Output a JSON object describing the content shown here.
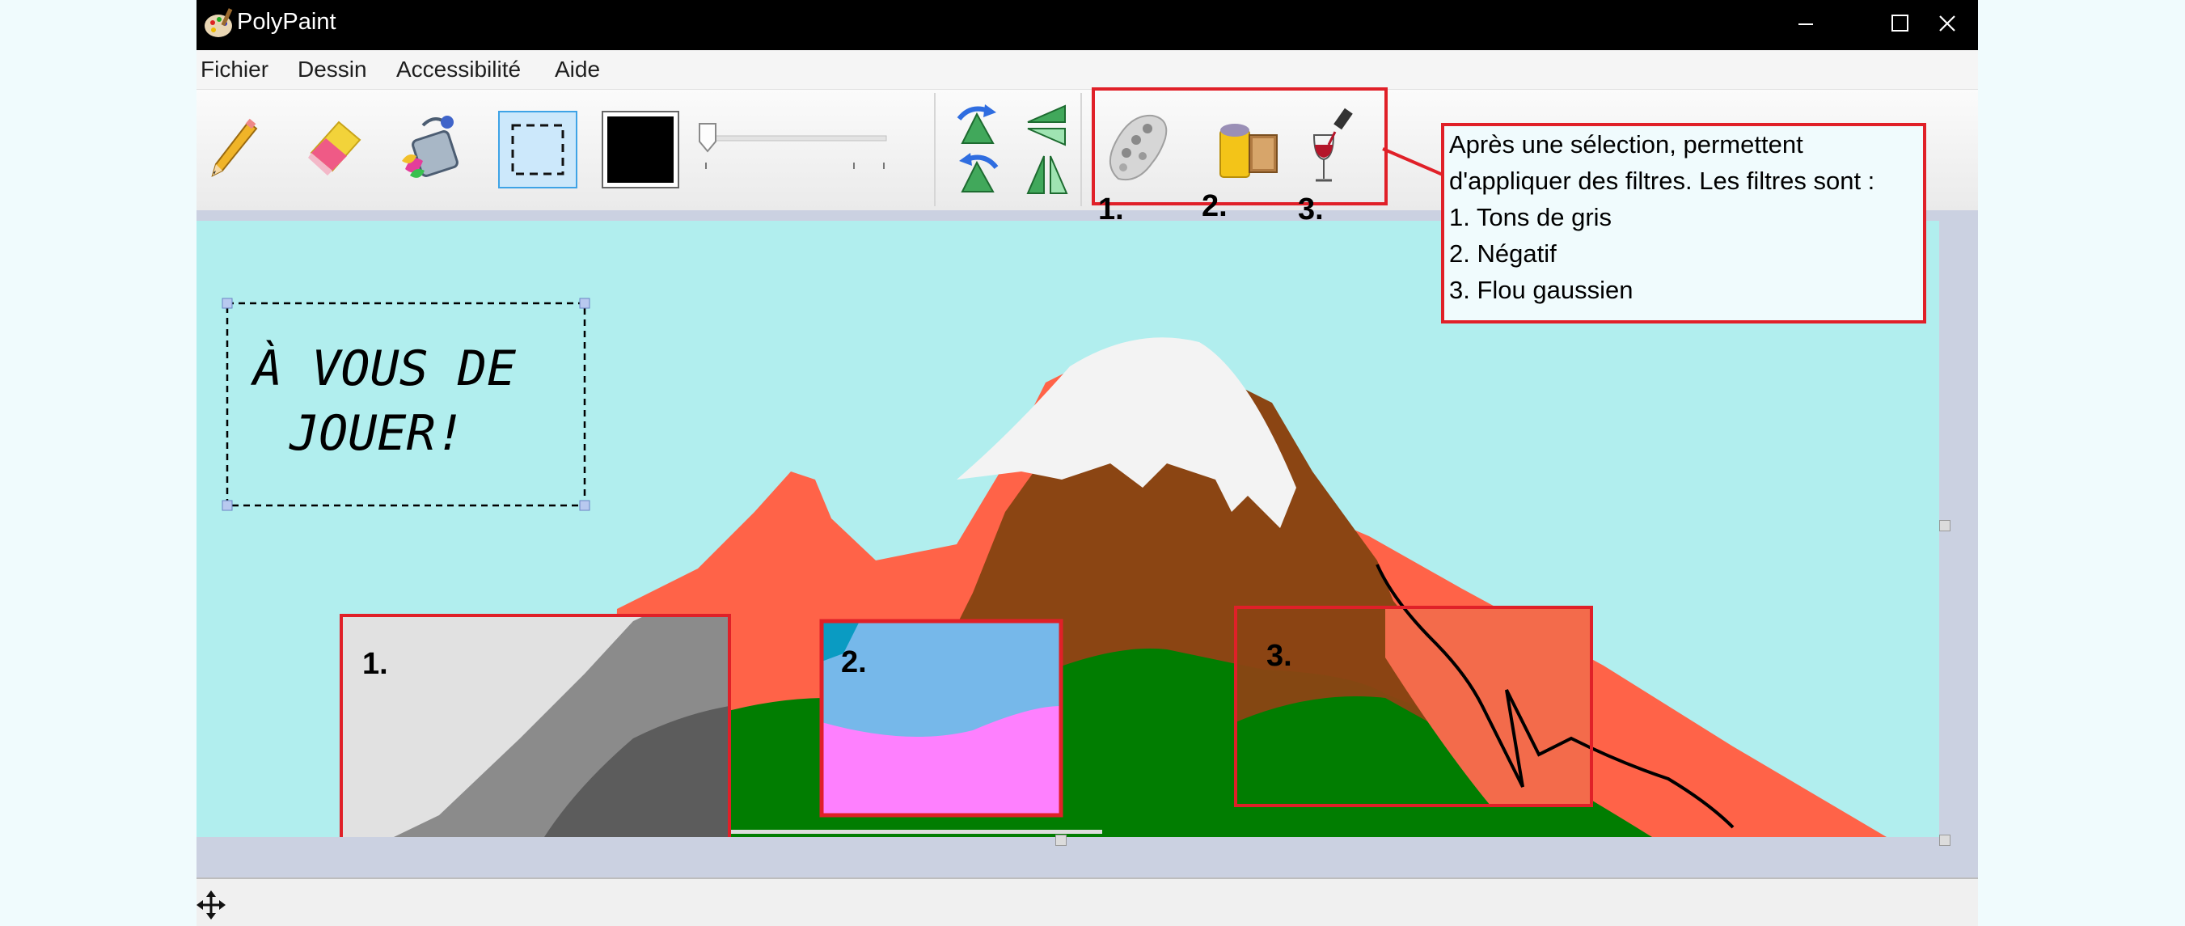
{
  "window": {
    "title": "PolyPaint"
  },
  "menu": {
    "items": [
      "Fichier",
      "Dessin",
      "Accessibilité",
      "Aide"
    ]
  },
  "toolbar": {
    "tools": [
      "pencil-icon",
      "eraser-icon",
      "paint-bucket-icon",
      "selection-icon",
      "color-swatch",
      "size-slider"
    ],
    "selected_tool": "selection",
    "current_color": "#000000",
    "transforms": [
      "rotate-left-icon",
      "flip-horizontal-icon",
      "rotate-right-icon",
      "flip-vertical-icon"
    ],
    "filters": [
      "palette-icon",
      "film-roll-icon",
      "wine-glass-icon"
    ],
    "filter_numbers": [
      "1.",
      "2.",
      "3."
    ]
  },
  "canvas": {
    "handwriting": [
      "À VOUS DE",
      "JOUER!"
    ],
    "region_labels": [
      "1.",
      "2.",
      "3."
    ],
    "background_color": "#b1eeee"
  },
  "callout": {
    "lines": [
      "Après une sélection, permettent",
      "d'appliquer des filtres. Les filtres sont :",
      "1. Tons de gris",
      "2. Négatif",
      "3. Flou gaussien"
    ]
  },
  "colors": {
    "annotation": "#e02028",
    "titlebar": "#000000"
  }
}
